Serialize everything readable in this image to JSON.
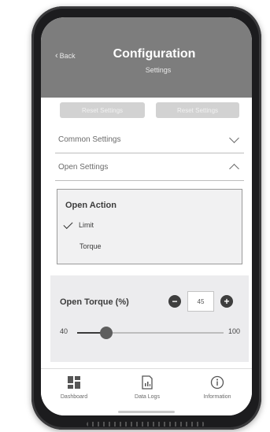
{
  "header": {
    "back_label": "Back",
    "title": "Configuration",
    "subtitle": "Settings"
  },
  "actions": {
    "reset_settings": "Reset Settings",
    "reset_settings_2": "Reset Settings"
  },
  "sections": {
    "common": "Common Settings",
    "open": "Open Settings"
  },
  "open_action": {
    "title": "Open Action",
    "options": [
      "Limit",
      "Torque"
    ],
    "selected": "Limit"
  },
  "open_torque": {
    "title": "Open Torque (%)",
    "value": "45",
    "min_label": "40",
    "max_label": "100",
    "slider_fraction": 0.2
  },
  "tabs": {
    "dashboard": "Dashboard",
    "data_logs": "Data Logs",
    "information": "Information"
  },
  "icons": {
    "back": "chevron-left-icon",
    "dashboard": "grid-icon",
    "data_logs": "document-chart-icon",
    "information": "info-circle-icon"
  },
  "colors": {
    "header_bg": "#7d7d7d",
    "card_bg": "#ececee",
    "phone_frame": "#1c1c1e"
  }
}
